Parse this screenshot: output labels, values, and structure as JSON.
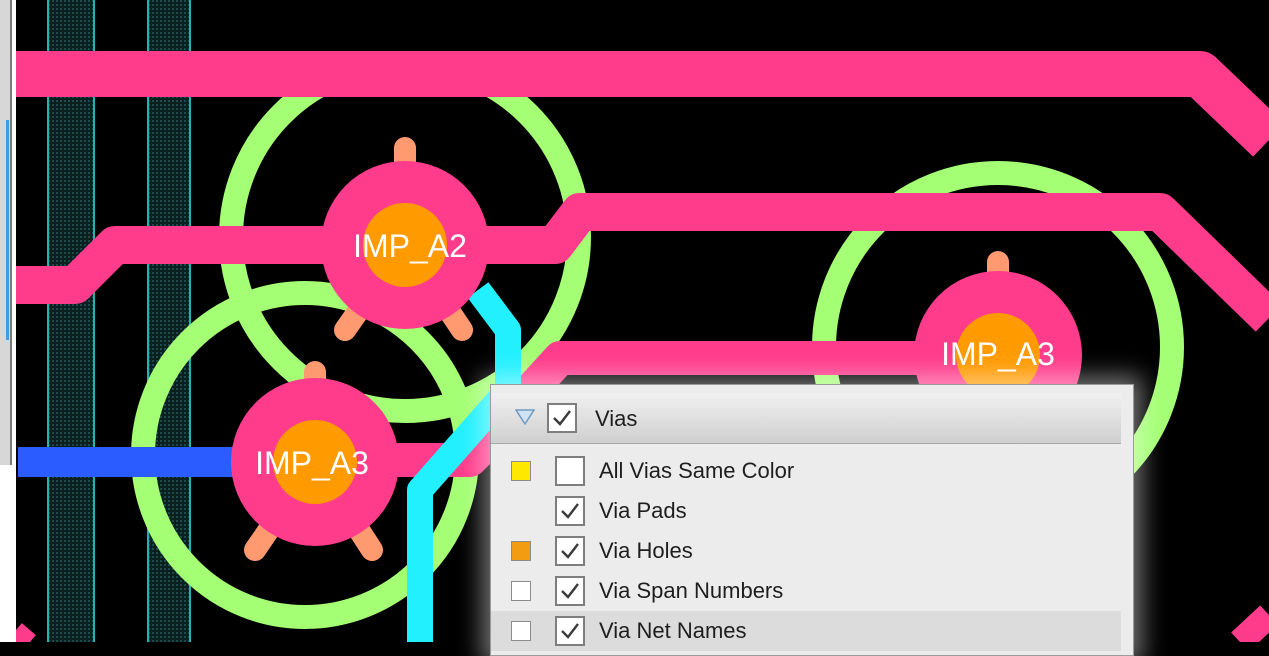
{
  "canvas": {
    "vias": [
      {
        "label": "IMP_A2"
      },
      {
        "label": "IMP_A3"
      },
      {
        "label": "IMP_A3"
      }
    ],
    "colors": {
      "background": "#000000",
      "trace_pink": "#ff3c8c",
      "trace_blue": "#2a5cff",
      "trace_cyan": "#22f0ff",
      "clearance_green": "#a4ff74",
      "via_hole_orange": "#ff9a00",
      "thermal_spoke": "#ff9a70",
      "grid_cyan": "#1fb3b3"
    }
  },
  "panel": {
    "header": {
      "expand_icon": "triangle-down-icon",
      "checked": true,
      "label": "Vias"
    },
    "items": [
      {
        "label": "All Vias Same Color",
        "checked": false,
        "swatch": "#ffe800"
      },
      {
        "label": "Via Pads",
        "checked": true,
        "swatch": null
      },
      {
        "label": "Via Holes",
        "checked": true,
        "swatch": "#f39c12"
      },
      {
        "label": "Via Span Numbers",
        "checked": true,
        "swatch": "#ffffff"
      },
      {
        "label": "Via Net Names",
        "checked": true,
        "swatch": "#ffffff"
      }
    ]
  }
}
